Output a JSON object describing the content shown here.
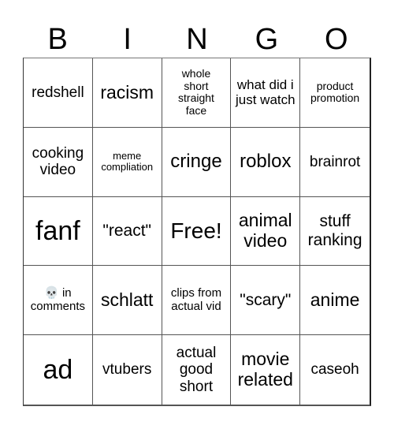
{
  "header": {
    "letters": [
      "B",
      "I",
      "N",
      "G",
      "O"
    ]
  },
  "board": {
    "cells": [
      "redshell",
      "racism",
      "whole short straight face",
      "what did i just watch",
      "product promotion",
      "cooking video",
      "meme compliation",
      "cringe",
      "roblox",
      "brainrot",
      "fanf",
      "\"react\"",
      "Free!",
      "animal video",
      "stuff ranking",
      "💀 in comments",
      "schlatt",
      "clips from actual vid",
      "\"scary\"",
      "anime",
      "ad",
      "vtubers",
      "actual good short",
      "movie related",
      "caseoh"
    ],
    "free_space_index": 12
  }
}
